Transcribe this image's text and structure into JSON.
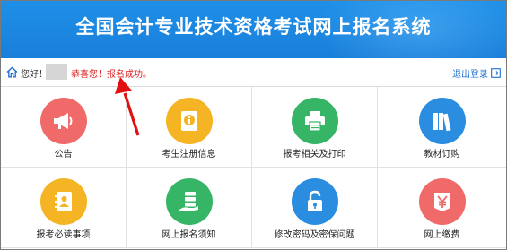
{
  "header": {
    "title": "全国会计专业技术资格考试网上报名系统"
  },
  "statusbar": {
    "greeting": "您好！",
    "message": "恭喜您！报名成功。",
    "logout_label": "退出登录"
  },
  "tiles": [
    {
      "label": "公告",
      "color": "#f06a6a",
      "icon": "megaphone-icon"
    },
    {
      "label": "考生注册信息",
      "color": "#f5b423",
      "icon": "info-document-icon"
    },
    {
      "label": "报考相关及打印",
      "color": "#35b565",
      "icon": "printer-icon"
    },
    {
      "label": "教材订购",
      "color": "#2a8de0",
      "icon": "books-icon"
    },
    {
      "label": "报考必读事项",
      "color": "#f5b423",
      "icon": "contact-book-icon"
    },
    {
      "label": "网上报名须知",
      "color": "#35b565",
      "icon": "server-hand-icon"
    },
    {
      "label": "修改密码及密保问题",
      "color": "#2a8de0",
      "icon": "lock-icon"
    },
    {
      "label": "网上缴费",
      "color": "#f06a6a",
      "icon": "yen-payment-icon"
    }
  ]
}
